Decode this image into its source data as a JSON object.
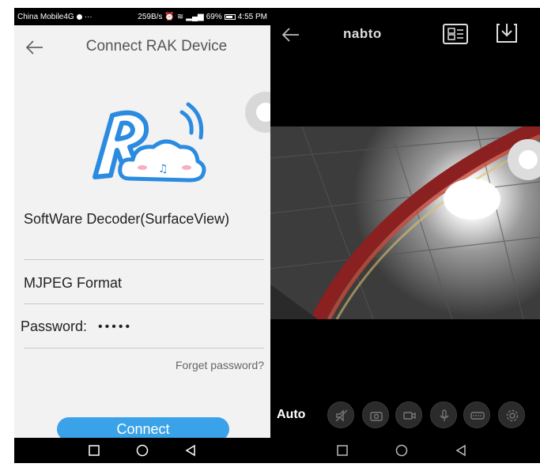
{
  "left_screen": {
    "status_bar": {
      "carrier": "China Mobile4G",
      "speed": "259B/s",
      "battery": "69%",
      "time": "4:55 PM"
    },
    "title": "Connect RAK Device",
    "decoder_label": "SoftWare Decoder(SurfaceView)",
    "format_label": "MJPEG Format",
    "password_label": "Password:",
    "password_mask": "•••••",
    "forget_password": "Forget password?",
    "connect_button": "Connect"
  },
  "right_screen": {
    "title": "nabto",
    "auto_label": "Auto",
    "controls": [
      "mute-icon",
      "snapshot-icon",
      "record-icon",
      "microphone-icon",
      "resolution-icon",
      "settings-icon"
    ]
  },
  "colors": {
    "accent": "#3aa2e8",
    "left_background": "#f2f2f2",
    "right_background": "#000000"
  }
}
